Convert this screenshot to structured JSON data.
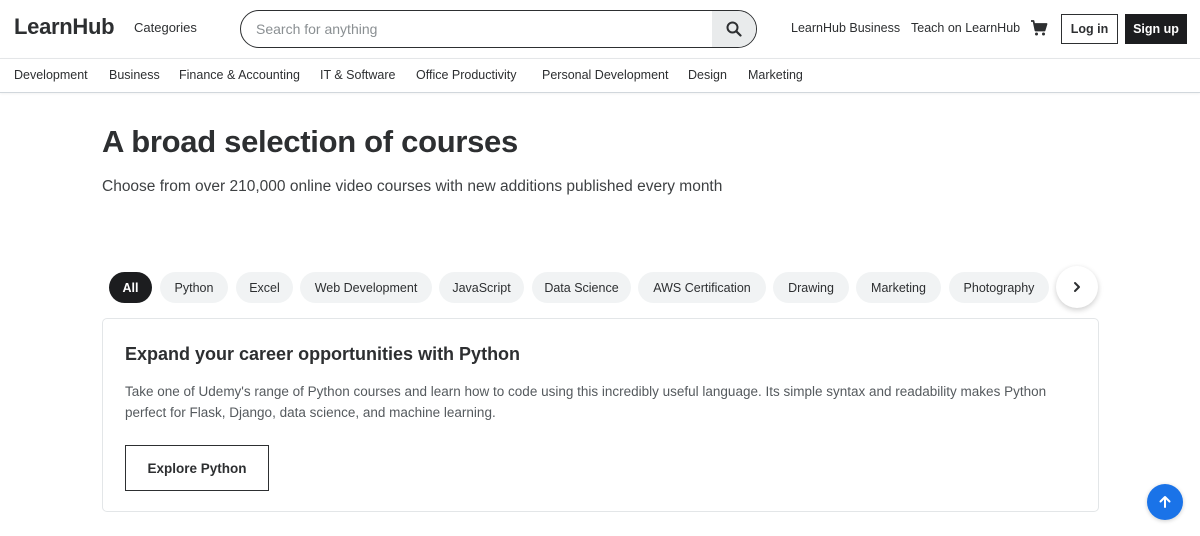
{
  "header": {
    "logo": "LearnHub",
    "categories_label": "Categories",
    "search_placeholder": "Search for anything",
    "business_link": "LearnHub Business",
    "teach_link": "Teach on LearnHub",
    "login_label": "Log in",
    "signup_label": "Sign up"
  },
  "category_nav": [
    "Development",
    "Business",
    "Finance & Accounting",
    "IT & Software",
    "Office Productivity",
    "Personal Development",
    "Design",
    "Marketing"
  ],
  "hero": {
    "title": "A broad selection of courses",
    "subtitle": "Choose from over 210,000 online video courses with new additions published every month"
  },
  "pills": [
    {
      "label": "All",
      "active": true
    },
    {
      "label": "Python",
      "active": false
    },
    {
      "label": "Excel",
      "active": false
    },
    {
      "label": "Web Development",
      "active": false
    },
    {
      "label": "JavaScript",
      "active": false
    },
    {
      "label": "Data Science",
      "active": false
    },
    {
      "label": "AWS Certification",
      "active": false
    },
    {
      "label": "Drawing",
      "active": false
    },
    {
      "label": "Marketing",
      "active": false
    },
    {
      "label": "Photography",
      "active": false
    }
  ],
  "card": {
    "title": "Expand your career opportunities with Python",
    "description": "Take one of Udemy's range of Python courses and learn how to code using this incredibly useful language. Its simple syntax and readability makes Python perfect for Flask, Django, data science, and machine learning.",
    "button_label": "Explore Python"
  },
  "icons": {
    "search": "search-icon",
    "cart": "cart-icon",
    "next": "chevron-right-icon",
    "scroll_top": "arrow-up-icon"
  },
  "colors": {
    "text": "#2d2f31",
    "dark_button": "#1c1d1f",
    "pill_bg": "#f1f3f4",
    "scroll_top": "#1a73e8"
  }
}
